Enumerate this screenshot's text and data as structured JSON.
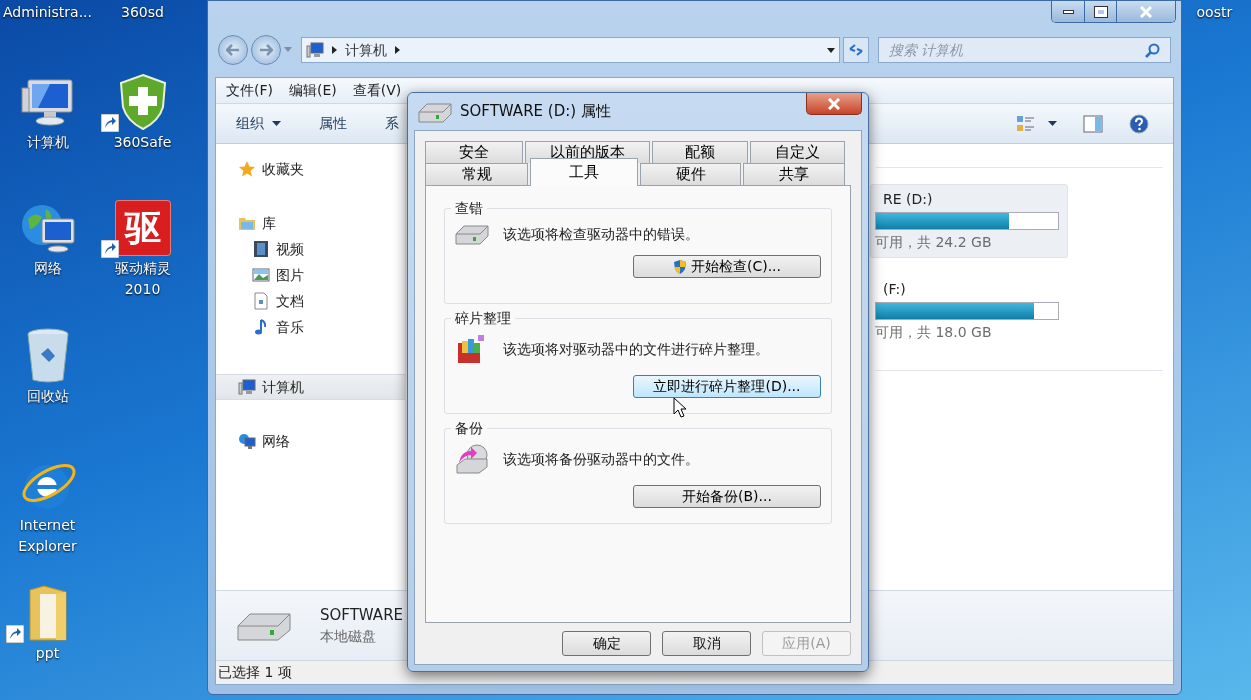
{
  "desktop_icons": [
    {
      "label": "Administra...",
      "kind": "cut"
    },
    {
      "label": "360sd",
      "kind": "cut"
    },
    {
      "label": "计算机",
      "kind": "computer",
      "shortcut": false
    },
    {
      "label": "360Safe",
      "kind": "shield",
      "shortcut": true
    },
    {
      "label": "网络",
      "kind": "network",
      "shortcut": false
    },
    {
      "label": "驱动精灵 2010",
      "kind": "logo",
      "logo_text": "驱",
      "shortcut": true
    },
    {
      "label": "回收站",
      "kind": "recycle",
      "shortcut": false
    },
    {
      "label": "Internet Explorer",
      "kind": "browser",
      "shortcut": false
    },
    {
      "label": "ppt",
      "kind": "folder",
      "shortcut": true
    },
    {
      "label": "oostr",
      "kind": "edge"
    }
  ],
  "explorer": {
    "breadcrumb": [
      "计算机"
    ],
    "search": {
      "placeholder": "搜索 计算机"
    },
    "menu": [
      "文件(F)",
      "编辑(E)",
      "查看(V)"
    ],
    "toolbar": [
      {
        "label": "组织",
        "kind": "dropdown"
      },
      {
        "label": "属性",
        "kind": "plain"
      },
      {
        "label": "系",
        "kind": "plain"
      }
    ],
    "nav": [
      {
        "label": "收藏夹",
        "kind": "star",
        "selected": false
      },
      {
        "label": "库",
        "kind": "library",
        "selected": false,
        "children": [
          {
            "label": "视频",
            "kind": "video",
            "selected": false
          },
          {
            "label": "图片",
            "kind": "picture",
            "selected": false
          },
          {
            "label": "文档",
            "kind": "document",
            "selected": false
          },
          {
            "label": "音乐",
            "kind": "music",
            "selected": false
          }
        ]
      },
      {
        "label": "计算机",
        "kind": "computer",
        "selected": true
      },
      {
        "label": "网络",
        "kind": "network",
        "selected": false
      }
    ],
    "drives": [
      {
        "name": "RE (D:)",
        "level": 0.73,
        "info": "可用，共 24.2 GB",
        "selected": true
      },
      {
        "name": "(F:)",
        "level": 0.87,
        "info": "可用，共 18.0 GB",
        "selected": false
      }
    ],
    "details": {
      "name": "SOFTWARE",
      "type": "本地磁盘"
    },
    "status_bar": "已选择 1 项"
  },
  "dialog": {
    "title": "SOFTWARE (D:) 属性",
    "tab_rows": [
      [
        {
          "label": "安全",
          "selected": false
        },
        {
          "label": "以前的版本",
          "selected": false
        },
        {
          "label": "配额",
          "selected": false
        },
        {
          "label": "自定义",
          "selected": false
        }
      ],
      [
        {
          "label": "常规",
          "selected": false
        },
        {
          "label": "工具",
          "selected": true
        },
        {
          "label": "硬件",
          "selected": false
        },
        {
          "label": "共享",
          "selected": false
        }
      ]
    ],
    "sections": [
      {
        "title": "查错",
        "kind": "check",
        "text": "该选项将检查驱动器中的错误。",
        "button": "开始检查(C)...",
        "shield": true,
        "hovered": false
      },
      {
        "title": "碎片整理",
        "kind": "defrag",
        "text": "该选项将对驱动器中的文件进行碎片整理。",
        "button": "立即进行碎片整理(D)...",
        "shield": false,
        "hovered": true
      },
      {
        "title": "备份",
        "kind": "backup",
        "text": "该选项将备份驱动器中的文件。",
        "button": "开始备份(B)...",
        "shield": false,
        "hovered": false
      }
    ],
    "buttons": [
      {
        "label": "确定",
        "disabled": false
      },
      {
        "label": "取消",
        "disabled": false
      },
      {
        "label": "应用(A)",
        "disabled": true
      }
    ]
  }
}
